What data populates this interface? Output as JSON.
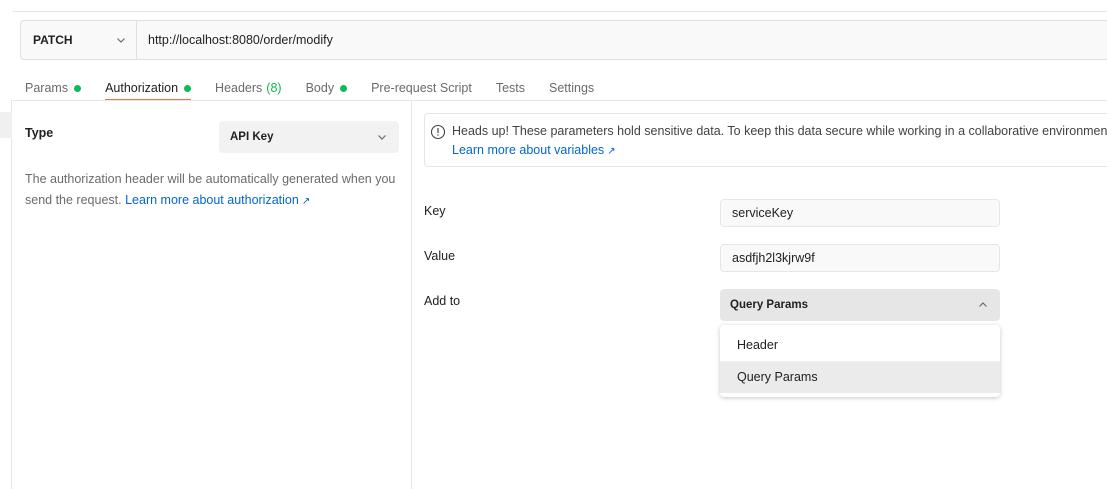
{
  "request": {
    "method": "PATCH",
    "url": "http://localhost:8080/order/modify"
  },
  "tabs": [
    {
      "label": "Params",
      "dot": true
    },
    {
      "label": "Authorization",
      "dot": true,
      "active": true
    },
    {
      "label": "Headers",
      "count": "(8)"
    },
    {
      "label": "Body",
      "dot": true
    },
    {
      "label": "Pre-request Script"
    },
    {
      "label": "Tests"
    },
    {
      "label": "Settings"
    }
  ],
  "auth": {
    "type_label": "Type",
    "type_value": "API Key",
    "description": "The authorization header will be automatically generated when you send the request.",
    "learn_more": "Learn more about authorization",
    "link_arrow": "↗"
  },
  "banner": {
    "text": "Heads up! These parameters hold sensitive data. To keep this data secure while working in a collaborative environment",
    "link": "Learn more about variables",
    "link_arrow": "↗"
  },
  "form": {
    "key_label": "Key",
    "key_value": "serviceKey",
    "value_label": "Value",
    "value_value": "asdfjh2l3kjrw9f",
    "addto_label": "Add to",
    "addto_value": "Query Params",
    "options": [
      "Header",
      "Query Params"
    ]
  },
  "colors": {
    "accent": "#ff6c37",
    "status_dot": "#0cbb52",
    "link": "#0265d2"
  }
}
